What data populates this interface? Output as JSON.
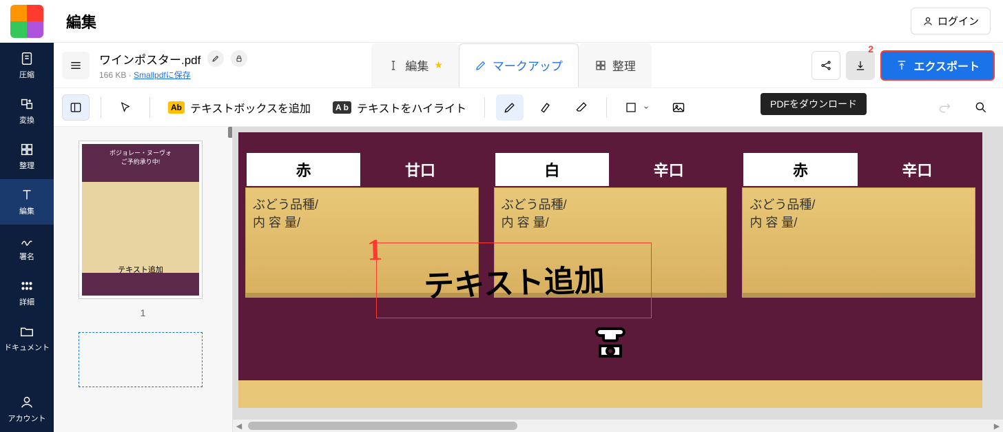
{
  "app": {
    "title": "編集"
  },
  "login": {
    "label": "ログイン"
  },
  "sidebar": {
    "items": [
      {
        "label": "圧縮"
      },
      {
        "label": "変換"
      },
      {
        "label": "整理"
      },
      {
        "label": "編集"
      },
      {
        "label": "署名"
      },
      {
        "label": "詳細"
      },
      {
        "label": "ドキュメント"
      },
      {
        "label": "アカウント"
      }
    ]
  },
  "file": {
    "name": "ワインポスター.pdf",
    "size": "166 KB",
    "save_link": "Smallpdfに保存"
  },
  "modes": {
    "edit": "編集",
    "markup": "マークアップ",
    "organize": "整理"
  },
  "export": {
    "label": "エクスポート",
    "tooltip": "PDFをダウンロード"
  },
  "toolbar": {
    "add_text": "テキストボックスを追加",
    "highlight": "テキストをハイライト",
    "ab": "Ab",
    "ab2": "A b"
  },
  "thumb": {
    "page": "1",
    "poster_line1": "ボジョレー・ヌーヴォ",
    "poster_line2": "ご予約承り中!",
    "hand": "テキスト追加"
  },
  "doc": {
    "cards": [
      {
        "color": "赤",
        "taste": "甘口",
        "t1": "ぶどう品種/",
        "t2": "内 容 量/"
      },
      {
        "color": "白",
        "taste": "辛口",
        "t1": "ぶどう品種/",
        "t2": "内 容 量/"
      },
      {
        "color": "赤",
        "taste": "辛口",
        "t1": "ぶどう品種/",
        "t2": "内 容 量/"
      }
    ],
    "handwrite": "テキスト追加"
  },
  "annotations": {
    "n1": "1",
    "n2": "2"
  }
}
